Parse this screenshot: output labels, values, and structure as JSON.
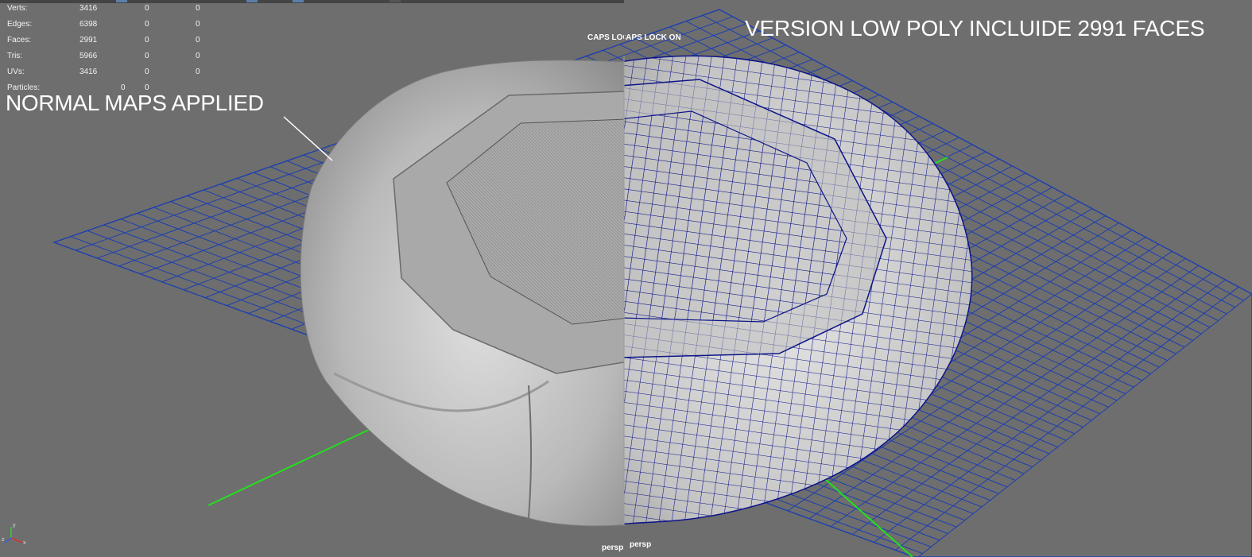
{
  "viewport": {
    "background": "#6e6e6e",
    "grid_color": "#1d3fae",
    "axis_color": "#22e01c",
    "wire_color": "#0d1488",
    "mesh_color": "#c9c9c9"
  },
  "stats": {
    "rows": [
      {
        "label": "Verts:",
        "v1": "3416",
        "v2": "0",
        "v3": "0"
      },
      {
        "label": "Edges:",
        "v1": "6398",
        "v2": "0",
        "v3": "0"
      },
      {
        "label": "Faces:",
        "v1": "2991",
        "v2": "0",
        "v3": "0"
      },
      {
        "label": "Tris:",
        "v1": "5966",
        "v2": "0",
        "v3": "0"
      },
      {
        "label": "UVs:",
        "v1": "3416",
        "v2": "0",
        "v3": "0"
      },
      {
        "label": "Particles:",
        "v1": "0",
        "v2": "0"
      }
    ]
  },
  "annotations": {
    "left": "NORMAL MAPS APPLIED",
    "right": "VERSION LOW POLY INCLUIDE 2991 FACES"
  },
  "status": {
    "caps_left": "CAPS LOCK ON",
    "caps_right": "CAPS LOCK ON"
  },
  "camera": {
    "left": "persp",
    "right": "persp"
  },
  "axis_gizmo": {
    "x_label": "x",
    "y_label": "y",
    "z_label": "z"
  }
}
